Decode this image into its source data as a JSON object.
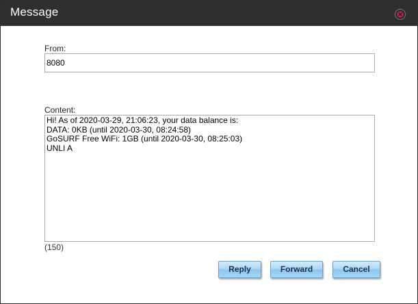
{
  "dialog": {
    "title": "Message",
    "close_icon": "close-icon"
  },
  "from": {
    "label": "From:",
    "value": "8080"
  },
  "content": {
    "label": "Content:",
    "value": "Hi! As of 2020-03-29, 21:06:23, your data balance is:\nDATA: 0KB (until 2020-03-30, 08:24:58)\nGoSURF Free WiFi: 1GB (until 2020-03-30, 08:25:03)\nUNLI A",
    "counter": "(150)"
  },
  "buttons": {
    "reply": "Reply",
    "forward": "Forward",
    "cancel": "Cancel"
  },
  "colors": {
    "titlebar": "#2f2f2f",
    "close_icon": "#c9245a",
    "button_gradient_top": "#d3ecfb",
    "button_gradient_bottom": "#8ac5f0"
  }
}
